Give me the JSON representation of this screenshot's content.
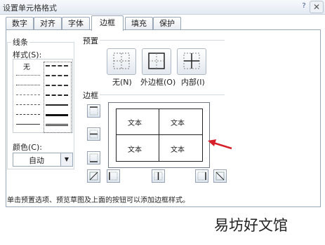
{
  "window": {
    "title": "设置单元格格式",
    "help": "?",
    "close": "✕"
  },
  "tabs": [
    {
      "label": "数字"
    },
    {
      "label": "对齐"
    },
    {
      "label": "字体"
    },
    {
      "label": "边框",
      "active": true
    },
    {
      "label": "填充"
    },
    {
      "label": "保护"
    }
  ],
  "line_group": {
    "title": "线条",
    "style_label": "样式(S):",
    "none_label": "无",
    "color_label": "颜色(C):",
    "color_value": "自动"
  },
  "presets": {
    "title": "预置",
    "items": [
      {
        "label": "无(N)",
        "icon": "border-none-icon"
      },
      {
        "label": "外边框(O)",
        "icon": "border-outline-icon"
      },
      {
        "label": "内部(I)",
        "icon": "border-inside-icon"
      }
    ]
  },
  "border": {
    "title": "边框",
    "cells": [
      "文本",
      "文本",
      "文本",
      "文本"
    ],
    "buttons": [
      "border-top-icon",
      "border-middle-horizontal-icon",
      "border-bottom-icon",
      "border-diagonal-up-icon",
      "border-left-icon",
      "border-middle-vertical-icon",
      "border-right-icon",
      "border-diagonal-down-icon"
    ]
  },
  "hint": "单击预置选项、预览草图及上面的按钮可以添加边框样式。",
  "watermark": "易坊好文馆",
  "colors": {
    "arrow": "#d6202a",
    "accent": "#3a6ea5"
  }
}
